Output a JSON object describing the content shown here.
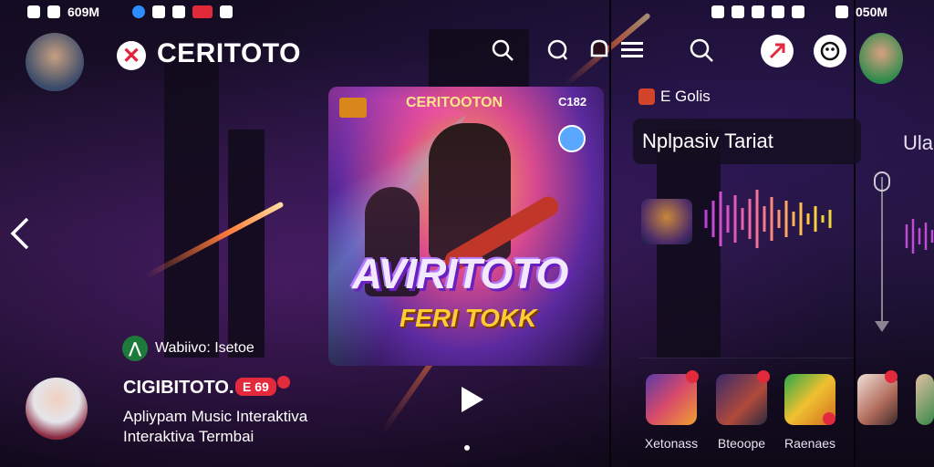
{
  "status_left": {
    "time": "609M"
  },
  "status_right": {
    "time": "050M"
  },
  "header": {
    "logo_glyph": "✕",
    "brand": "CERITOTO"
  },
  "album": {
    "top_label": "CERITOOTON",
    "corner_label": "C182",
    "title": "AVIRITOTO",
    "subtitle": "FERI TOKK"
  },
  "tag": {
    "icon_glyph": "⋀",
    "label": "Wabiivo: Isetoe"
  },
  "now_playing": {
    "title": "CIGIBITOTO.",
    "badge": "E 69",
    "description": "Apliypam Music Interaktiva Interaktiva Termbai"
  },
  "middle": {
    "section_label": "E Golis",
    "search_text": "Nplpasiv Tariat",
    "apps": [
      {
        "label": "Xetonass"
      },
      {
        "label": "Bteoope"
      },
      {
        "label": "Raenaes"
      }
    ]
  },
  "right": {
    "label": "Ulau"
  },
  "colors": {
    "accent": "#e22a3c",
    "brand_bg": "#ffffff",
    "tag": "#1e7a3a"
  },
  "icons": [
    "back-chevron-icon",
    "search-icon",
    "chat-icon",
    "notification-icon",
    "menu-icon",
    "share-icon",
    "face-icon",
    "play-icon"
  ]
}
